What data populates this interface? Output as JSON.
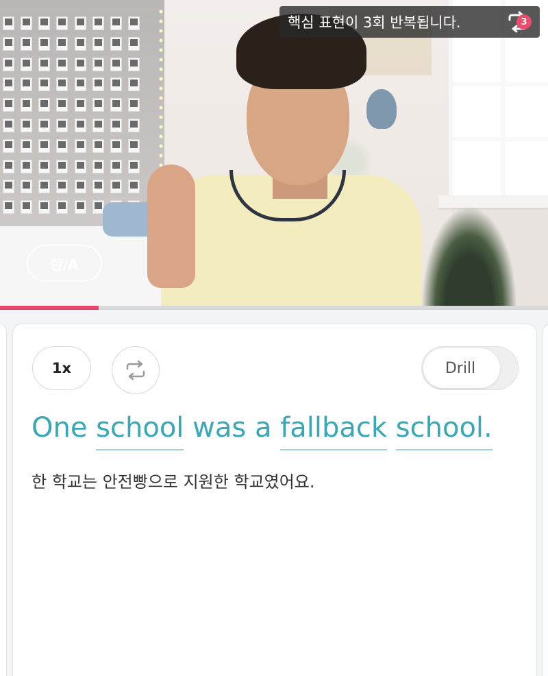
{
  "video": {
    "repeat_notice": "핵심 표현이 3회 반복됩니다.",
    "repeat_count": "3",
    "language_toggle_label": "한/A",
    "progress_fraction": 0.18,
    "colors": {
      "progress": "#e8466d",
      "badge": "#ea4c6a"
    }
  },
  "controls": {
    "speed_label": "1x",
    "loop_icon": "repeat-icon",
    "drill_label": "Drill",
    "drill_enabled": false
  },
  "sentence": {
    "words": [
      {
        "text": "One",
        "highlighted": false
      },
      {
        "text": "school",
        "highlighted": true
      },
      {
        "text": "was",
        "highlighted": false
      },
      {
        "text": "a",
        "highlighted": false
      },
      {
        "text": "fallback",
        "highlighted": true
      },
      {
        "text": "school.",
        "highlighted": true
      }
    ],
    "translation": "한 학교는 안전빵으로 지원한 학교였어요.",
    "colors": {
      "text": "#38a7b8",
      "underline": "#9fd1d8"
    }
  }
}
